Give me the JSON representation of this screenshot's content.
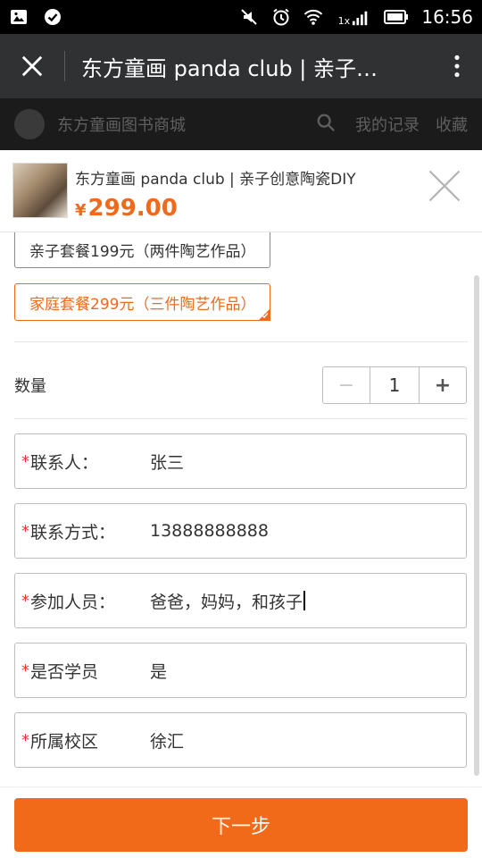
{
  "status_bar": {
    "time": "16:56",
    "network_label": "1x"
  },
  "titlebar": {
    "title": "东方童画 panda club | 亲子…"
  },
  "background_page": {
    "store_name": "东方童画图书商城",
    "nav_records": "我的记录",
    "nav_favorites": "收藏"
  },
  "product": {
    "title": "东方童画 panda club | 亲子创意陶瓷DIY",
    "currency": "¥",
    "price": "299.00"
  },
  "packages": [
    {
      "label": "亲子套餐199元（两件陶艺作品）",
      "selected": false
    },
    {
      "label": "家庭套餐299元（三件陶艺作品）",
      "selected": true
    }
  ],
  "quantity": {
    "label": "数量",
    "minus": "−",
    "value": "1",
    "plus": "+"
  },
  "form": {
    "required_mark": "*",
    "fields": [
      {
        "label": "联系人：",
        "value": "张三"
      },
      {
        "label": "联系方式：",
        "value": "13888888888"
      },
      {
        "label": "参加人员：",
        "value": "爸爸，妈妈，和孩子"
      },
      {
        "label": "是否学员",
        "value": "是"
      },
      {
        "label": "所属校区",
        "value": "徐汇"
      }
    ]
  },
  "footer": {
    "next_label": "下一步"
  },
  "colors": {
    "accent": "#ef6a1d",
    "required": "#ee3333",
    "titlebar": "#2f3133"
  }
}
